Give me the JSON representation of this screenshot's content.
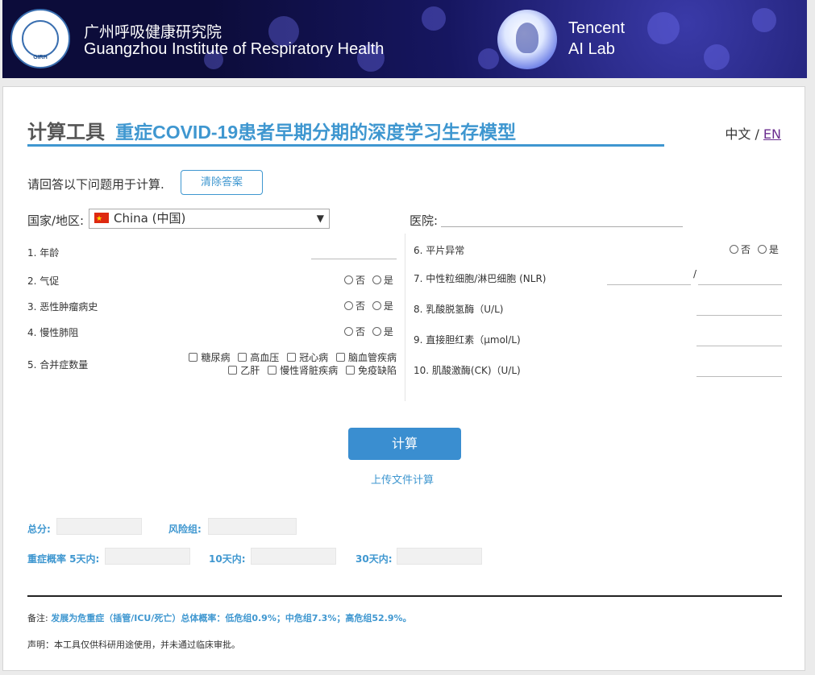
{
  "header": {
    "logo_text": "GIRH",
    "institute_cn": "广州呼吸健康研究院",
    "institute_en": "Guangzhou Institute of Respiratory Health",
    "partner_line1": "Tencent",
    "partner_line2": "AI Lab"
  },
  "title": {
    "main": "计算工具",
    "sub": "重症COVID-19患者早期分期的深度学习生存模型"
  },
  "lang": {
    "cn": "中文",
    "sep": " / ",
    "en": "EN"
  },
  "form": {
    "prompt": "请回答以下问题用于计算.",
    "clear_button": "清除答案",
    "country_label": "国家/地区:",
    "country_value": "China (中国)",
    "hospital_label": "医院:",
    "no_label": "否",
    "yes_label": "是",
    "questions_left": [
      "1. 年龄",
      "2. 气促",
      "3. 恶性肿瘤病史",
      "4. 慢性肺阻",
      "5. 合并症数量"
    ],
    "comorbidities_row1": [
      "糖尿病",
      "高血压",
      "冠心病",
      "脑血管疾病"
    ],
    "comorbidities_row2": [
      "乙肝",
      "慢性肾脏疾病",
      "免疫缺陷"
    ],
    "questions_right": [
      "6. 平片异常",
      "7. 中性粒细胞/淋巴细胞 (NLR)",
      "8. 乳酸脱氢酶（U/L)",
      "9. 直接胆红素（μmol/L)",
      "10. 肌酸激酶(CK)（U/L)"
    ],
    "nlr_separator": "/"
  },
  "actions": {
    "calculate": "计算",
    "upload": "上传文件计算"
  },
  "results": {
    "total_label": "总分:",
    "risk_group_label": "风险组:",
    "prob_5d_label": "重症概率 5天内:",
    "prob_10d_label": "10天内:",
    "prob_30d_label": "30天内:"
  },
  "footer": {
    "note_prefix": "备注: ",
    "note_highlight": "发展为危重症（插管/ICU/死亡）总体概率：低危组0.9%；中危组7.3%；高危组52.9%。",
    "disclaimer": "声明：本工具仅供科研用途使用，并未通过临床审批。"
  }
}
